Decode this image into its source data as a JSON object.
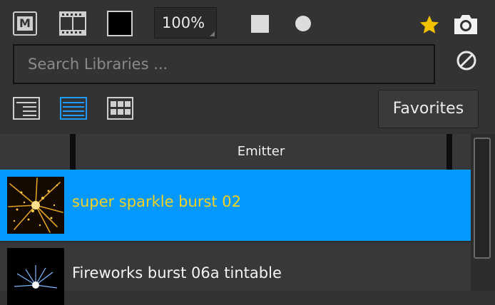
{
  "toolbar": {
    "mode_button_label": "M",
    "zoom_value": "100%",
    "icons": {
      "mode": "m-icon",
      "film": "film-strip-icon",
      "background": "black-square-icon",
      "square": "square-shape-icon",
      "circle": "circle-shape-icon",
      "favorite": "star-icon",
      "snapshot": "camera-icon"
    },
    "accent_color": "#f2c200"
  },
  "search": {
    "placeholder": "Search Libraries ..."
  },
  "view": {
    "modes": [
      "list-detail-icon",
      "list-icon",
      "grid-icon"
    ],
    "active_mode": "list-icon",
    "favorites_label": "Favorites"
  },
  "table": {
    "column_header": "Emitter",
    "rows": [
      {
        "label": "super sparkle burst 02",
        "selected": true,
        "thumbnail": "gold-sparkle-burst"
      },
      {
        "label": "Fireworks burst 06a tintable",
        "selected": false,
        "thumbnail": "blue-white-firework"
      }
    ],
    "selection_color": "#0599ff",
    "selected_text_color": "#f2d21e"
  }
}
